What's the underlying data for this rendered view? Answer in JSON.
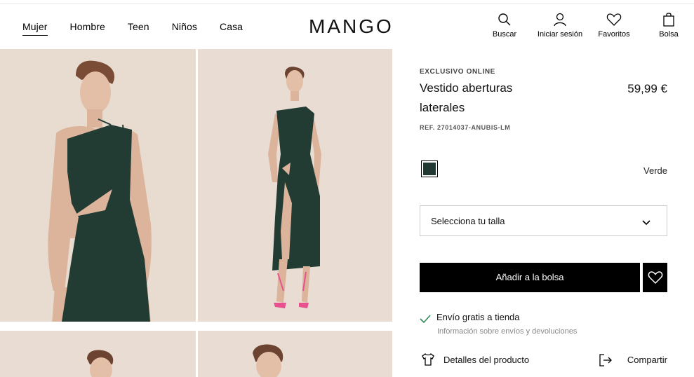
{
  "nav": {
    "items": [
      "Mujer",
      "Hombre",
      "Teen",
      "Niños",
      "Casa"
    ],
    "active": "Mujer"
  },
  "logo": "MANGO",
  "tools": {
    "search": "Buscar",
    "login": "Iniciar sesión",
    "favorites": "Favoritos",
    "bag": "Bolsa"
  },
  "product": {
    "tag": "EXCLUSIVO ONLINE",
    "name": "Vestido aberturas laterales",
    "price": "59,99 €",
    "ref": "REF. 27014037-ANUBIS-LM",
    "color_name": "Verde",
    "color_hex": "#233a34",
    "size_placeholder": "Selecciona tu talla",
    "add_to_bag": "Añadir a la bolsa",
    "shipping_title": "Envío gratis a tienda",
    "shipping_info": "Información sobre envíos y devoluciones",
    "details": "Detalles del producto",
    "share": "Compartir"
  },
  "colors": {
    "accent": "#000000",
    "check": "#2e8b57",
    "image_bg": "#e9ddd2",
    "dress": "#223b33"
  }
}
